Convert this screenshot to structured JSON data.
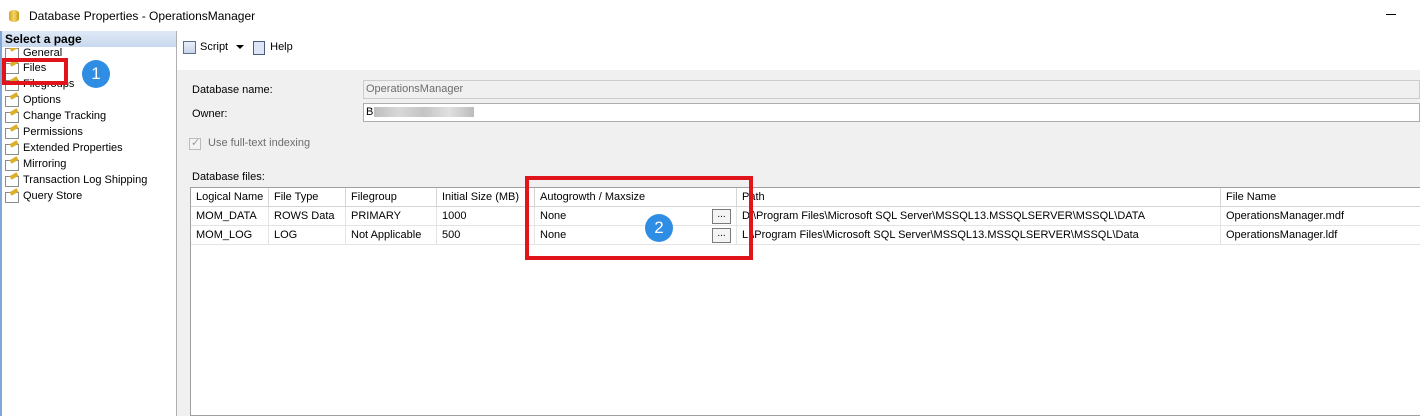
{
  "window": {
    "title": "Database Properties - OperationsManager"
  },
  "sidebar": {
    "header": "Select a page",
    "items": [
      {
        "label": "General"
      },
      {
        "label": "Files"
      },
      {
        "label": "Filegroups"
      },
      {
        "label": "Options"
      },
      {
        "label": "Change Tracking"
      },
      {
        "label": "Permissions"
      },
      {
        "label": "Extended Properties"
      },
      {
        "label": "Mirroring"
      },
      {
        "label": "Transaction Log Shipping"
      },
      {
        "label": "Query Store"
      }
    ]
  },
  "toolbar": {
    "script_label": "Script",
    "help_label": "Help"
  },
  "form": {
    "database_name_label": "Database name:",
    "database_name_value": "OperationsManager",
    "owner_label": "Owner:",
    "owner_value": "B",
    "fulltext_label": "Use full-text indexing",
    "database_files_label": "Database files:"
  },
  "grid": {
    "columns": [
      "Logical Name",
      "File Type",
      "Filegroup",
      "Initial Size (MB)",
      "Autogrowth / Maxsize",
      "Path",
      "File Name"
    ],
    "rows": [
      [
        "MOM_DATA",
        "ROWS Data",
        "PRIMARY",
        "1000",
        "None",
        "D:\\Program Files\\Microsoft SQL Server\\MSSQL13.MSSQLSERVER\\MSSQL\\DATA",
        "OperationsManager.mdf"
      ],
      [
        "MOM_LOG",
        "LOG",
        "Not Applicable",
        "500",
        "None",
        "L:\\Program Files\\Microsoft SQL Server\\MSSQL13.MSSQLSERVER\\MSSQL\\Data",
        "OperationsManager.ldf"
      ]
    ],
    "ellipsis_label": "..."
  },
  "annotations": {
    "badge1": "1",
    "badge2": "2"
  },
  "colors": {
    "annotation_red": "#e0141a",
    "badge_blue": "#2f8de4"
  }
}
